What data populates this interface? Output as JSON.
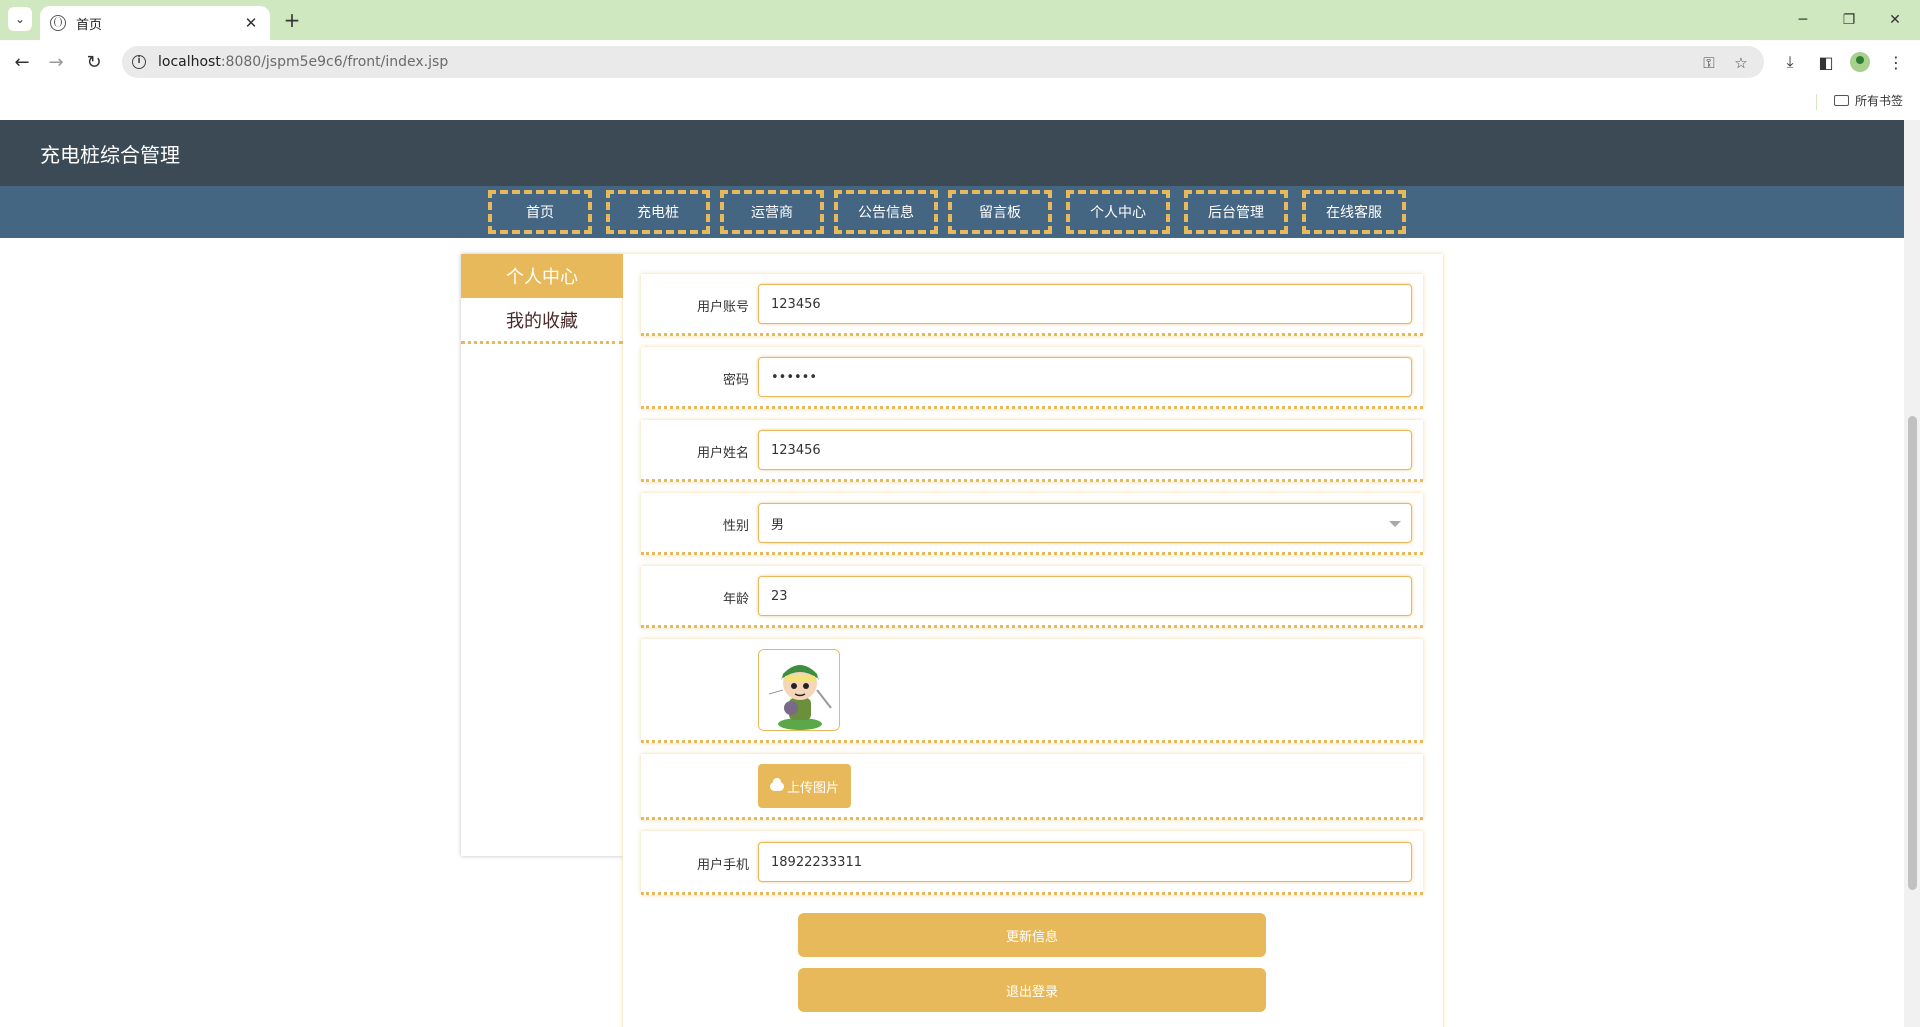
{
  "browser": {
    "tab_title": "首页",
    "url_host": "localhost",
    "url_path": ":8080/jspm5e9c6/front/index.jsp",
    "bookmarks_folder": "所有书签"
  },
  "site": {
    "title": "充电桩综合管理",
    "nav": [
      "首页",
      "充电桩",
      "运营商",
      "公告信息",
      "留言板",
      "个人中心",
      "后台管理",
      "在线客服"
    ]
  },
  "sidebar": {
    "items": [
      "个人中心",
      "我的收藏"
    ],
    "active": "个人中心"
  },
  "form": {
    "account_label": "用户账号",
    "account_value": "123456",
    "password_label": "密码",
    "password_value": "••••••",
    "name_label": "用户姓名",
    "name_value": "123456",
    "gender_label": "性别",
    "gender_value": "男",
    "age_label": "年龄",
    "age_value": "23",
    "upload_label": "上传图片",
    "phone_label": "用户手机",
    "phone_value": "18922233311"
  },
  "actions": {
    "update": "更新信息",
    "logout": "退出登录"
  },
  "colors": {
    "accent": "#e8b95a",
    "header": "#3b4a55",
    "nav_bar": "#456683",
    "tab_strip": "#cfe8c0"
  }
}
